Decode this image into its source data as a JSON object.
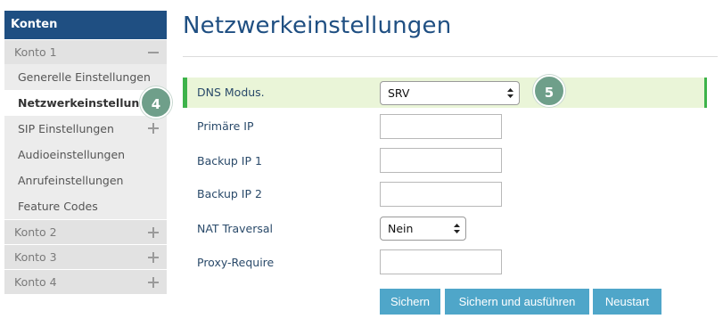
{
  "sidebar": {
    "header": "Konten",
    "account1": {
      "label": "Konto 1",
      "items": [
        {
          "label": "Generelle Einstellungen"
        },
        {
          "label": "Netzwerkeinstellungen"
        },
        {
          "label": "SIP Einstellungen"
        },
        {
          "label": "Audioeinstellungen"
        },
        {
          "label": "Anrufeinstellungen"
        },
        {
          "label": "Feature Codes"
        }
      ]
    },
    "accounts": [
      {
        "label": "Konto 2"
      },
      {
        "label": "Konto 3"
      },
      {
        "label": "Konto 4"
      }
    ]
  },
  "badges": {
    "step4": "4",
    "step5": "5"
  },
  "main": {
    "title": "Netzwerkeinstellungen",
    "fields": {
      "dns_mode": {
        "label": "DNS Modus.",
        "value": "SRV"
      },
      "primary_ip": {
        "label": "Primäre IP",
        "value": ""
      },
      "backup_ip1": {
        "label": "Backup IP 1",
        "value": ""
      },
      "backup_ip2": {
        "label": "Backup IP 2",
        "value": ""
      },
      "nat_traversal": {
        "label": "NAT Traversal",
        "value": "Nein"
      },
      "proxy_require": {
        "label": "Proxy-Require",
        "value": ""
      }
    },
    "buttons": {
      "save": "Sichern",
      "save_apply": "Sichern und ausführen",
      "restart": "Neustart"
    }
  },
  "colors": {
    "brand": "#1f4f82",
    "highlight_bg": "#eaf5d8",
    "highlight_border": "#3db34a",
    "button": "#4fa6c9",
    "badge": "#6f9f8a"
  }
}
